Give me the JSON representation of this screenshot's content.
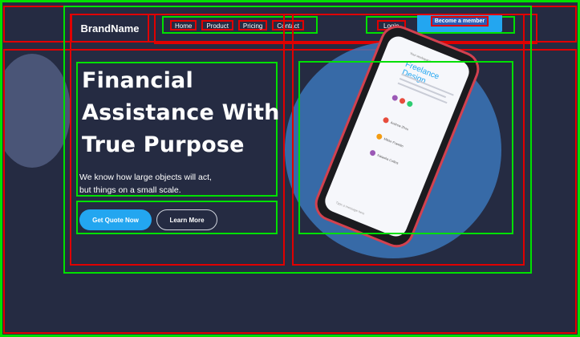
{
  "brand": "BrandName",
  "nav": {
    "links": [
      "Home",
      "Product",
      "Pricing",
      "Contact"
    ],
    "login": "Login",
    "member": "Become a member"
  },
  "hero": {
    "headline_line1": "Financial",
    "headline_line2": "Assistance With",
    "headline_line3": "True Purpose",
    "subtext_line1": "We know how large objects will act,",
    "subtext_line2": "but things on a small scale.",
    "cta_primary": "Get Quote Now",
    "cta_secondary": "Learn More"
  },
  "phone": {
    "tag": "Your workspace",
    "title": "Freelance Design",
    "users": [
      "Andrew Zhou",
      "Mikke Franklin",
      "Natasha Collins"
    ],
    "input_placeholder": "Type a message here"
  },
  "colors": {
    "background": "#252b42",
    "accent": "#23a6f0",
    "annotation_red": "#e00000",
    "annotation_green": "#00e000"
  }
}
